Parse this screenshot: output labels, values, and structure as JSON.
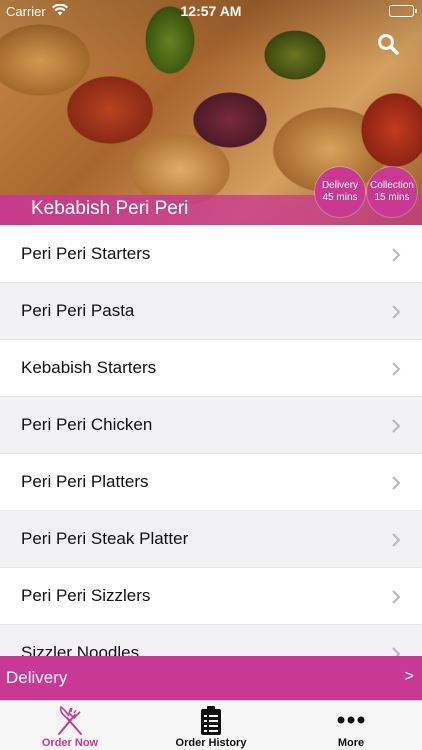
{
  "status_bar": {
    "carrier": "Carrier",
    "time": "12:57 AM"
  },
  "restaurant": {
    "name": "Kebabish Peri Peri",
    "delivery": {
      "label": "Delivery",
      "time": "45 mins"
    },
    "collection": {
      "label": "Collection",
      "time": "15 mins"
    }
  },
  "menu": {
    "items": [
      "Peri Peri Starters",
      "Peri Peri Pasta",
      "Kebabish Starters",
      "Peri Peri Chicken",
      "Peri Peri Platters",
      "Peri Peri Steak Platter",
      "Peri Peri Sizzlers",
      "Sizzler Noodles"
    ]
  },
  "order_bar": {
    "label": "Delivery",
    "arrow": ">"
  },
  "tabs": [
    {
      "label": "Order Now",
      "icon": "fork-knife-icon",
      "active": true
    },
    {
      "label": "Order History",
      "icon": "clipboard-list-icon",
      "active": false
    },
    {
      "label": "More",
      "icon": "more-dots-icon",
      "active": false
    }
  ],
  "colors": {
    "accent": "#c93892",
    "list_alt_bg": "#f2f2f4",
    "tab_bg": "#f7f7f7"
  }
}
